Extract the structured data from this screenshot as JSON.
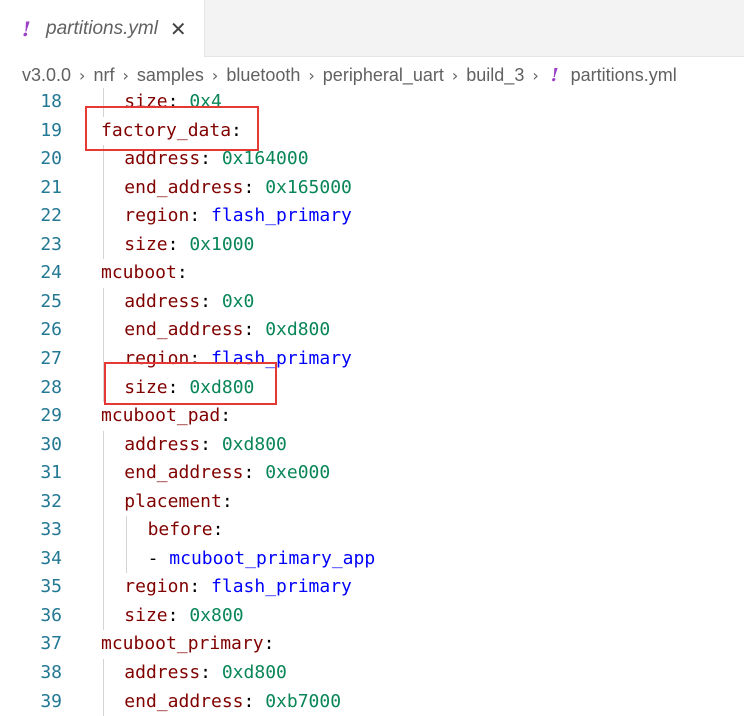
{
  "tab": {
    "icon": "!",
    "label": "partitions.yml",
    "close": "✕"
  },
  "breadcrumb": {
    "items": [
      "v3.0.0",
      "nrf",
      "samples",
      "bluetooth",
      "peripheral_uart",
      "build_3"
    ],
    "file_icon": "!",
    "file": "partitions.yml",
    "separator": "›"
  },
  "lines": [
    {
      "n": "18",
      "indent": 1,
      "key": "size",
      "value": "0x4",
      "type": "num"
    },
    {
      "n": "19",
      "indent": 0,
      "key": "factory_data",
      "value": "",
      "type": ""
    },
    {
      "n": "20",
      "indent": 1,
      "key": "address",
      "value": "0x164000",
      "type": "num"
    },
    {
      "n": "21",
      "indent": 1,
      "key": "end_address",
      "value": "0x165000",
      "type": "num"
    },
    {
      "n": "22",
      "indent": 1,
      "key": "region",
      "value": "flash_primary",
      "type": "str"
    },
    {
      "n": "23",
      "indent": 1,
      "key": "size",
      "value": "0x1000",
      "type": "num"
    },
    {
      "n": "24",
      "indent": 0,
      "key": "mcuboot",
      "value": "",
      "type": ""
    },
    {
      "n": "25",
      "indent": 1,
      "key": "address",
      "value": "0x0",
      "type": "num"
    },
    {
      "n": "26",
      "indent": 1,
      "key": "end_address",
      "value": "0xd800",
      "type": "num"
    },
    {
      "n": "27",
      "indent": 1,
      "key": "region",
      "value": "flash_primary",
      "type": "str"
    },
    {
      "n": "28",
      "indent": 1,
      "key": "size",
      "value": "0xd800",
      "type": "num"
    },
    {
      "n": "29",
      "indent": 0,
      "key": "mcuboot_pad",
      "value": "",
      "type": ""
    },
    {
      "n": "30",
      "indent": 1,
      "key": "address",
      "value": "0xd800",
      "type": "num"
    },
    {
      "n": "31",
      "indent": 1,
      "key": "end_address",
      "value": "0xe000",
      "type": "num"
    },
    {
      "n": "32",
      "indent": 1,
      "key": "placement",
      "value": "",
      "type": ""
    },
    {
      "n": "33",
      "indent": 2,
      "key": "before",
      "value": "",
      "type": ""
    },
    {
      "n": "34",
      "indent": 2,
      "key": "",
      "value": "mcuboot_primary_app",
      "type": "list"
    },
    {
      "n": "35",
      "indent": 1,
      "key": "region",
      "value": "flash_primary",
      "type": "str"
    },
    {
      "n": "36",
      "indent": 1,
      "key": "size",
      "value": "0x800",
      "type": "num"
    },
    {
      "n": "37",
      "indent": 0,
      "key": "mcuboot_primary",
      "value": "",
      "type": ""
    },
    {
      "n": "38",
      "indent": 1,
      "key": "address",
      "value": "0xd800",
      "type": "num"
    },
    {
      "n": "39",
      "indent": 1,
      "key": "end_address",
      "value": "0xb7000",
      "type": "num"
    }
  ],
  "highlight_color": "#e53935"
}
